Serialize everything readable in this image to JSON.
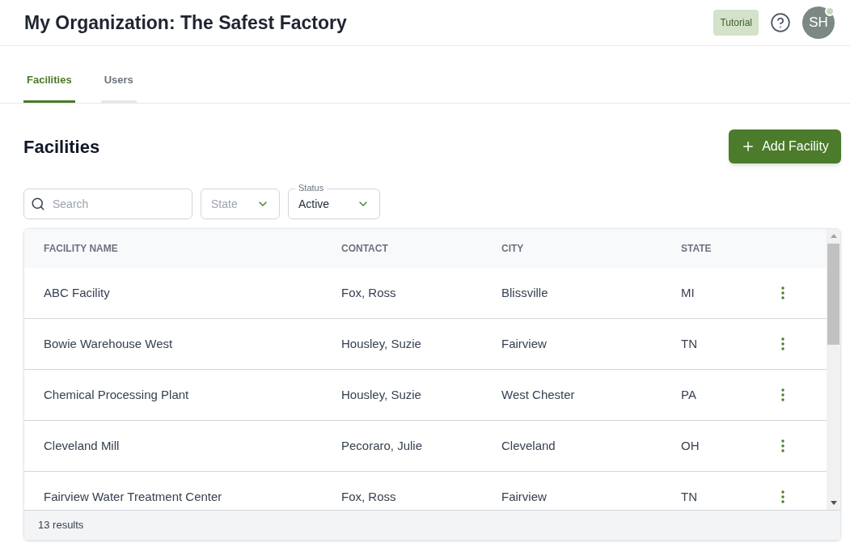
{
  "header": {
    "title": "My Organization: The Safest Factory",
    "tutorial_button": "Tutorial",
    "avatar": {
      "initials": "SH",
      "online": true
    }
  },
  "tabs": [
    {
      "label": "Facilities",
      "selected": true
    },
    {
      "label": "Users",
      "selected": false
    }
  ],
  "page": {
    "title": "Facilities",
    "add_button": "Add Facility"
  },
  "filters": {
    "search": {
      "placeholder": "Search"
    },
    "state": {
      "placeholder": "State"
    },
    "status": {
      "label": "Status",
      "value": "Active"
    }
  },
  "table": {
    "columns": [
      "FACILITY NAME",
      "CONTACT",
      "CITY",
      "STATE"
    ],
    "rows": [
      [
        "ABC Facility",
        "Fox, Ross",
        "Blissville",
        "MI"
      ],
      [
        "Bowie Warehouse West",
        "Housley, Suzie",
        "Fairview",
        "TN"
      ],
      [
        "Chemical Processing Plant",
        "Housley, Suzie",
        "West Chester",
        "PA"
      ],
      [
        "Cleveland Mill",
        "Pecoraro, Julie",
        "Cleveland",
        "OH"
      ],
      [
        "Fairview Water Treatment Center",
        "Fox, Ross",
        "Fairview",
        "TN"
      ]
    ],
    "footer": "13 results"
  }
}
